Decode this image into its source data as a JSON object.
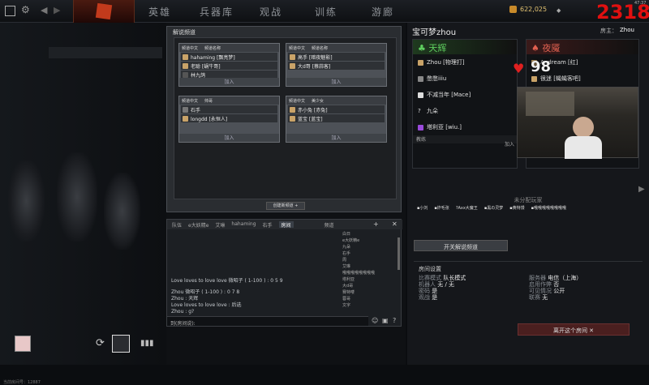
{
  "topbar": {
    "tabs": [
      "英雄",
      "兵器库",
      "观战",
      "训练",
      "游廊"
    ],
    "gold": "622,025",
    "score": "2318",
    "time": "47:37"
  },
  "panel": {
    "title": "解说频道",
    "channels": [
      {
        "head": [
          "频道中文",
          "频道名称"
        ],
        "rows": [
          "hahaming [飘亮梦]",
          "老聪 [蜗牛哥]",
          "林九鸽"
        ],
        "join": "加入"
      },
      {
        "head": [
          "频道中文",
          "频道名称"
        ],
        "rows": [
          "高手 [暗夜魅影]",
          "大d哥 [蔡蒜客]"
        ],
        "join": "加入"
      },
      {
        "head": [
          "频道中文",
          "帅哥"
        ],
        "rows": [
          "石手",
          "longdd [永恒人]"
        ],
        "join": "加入"
      },
      {
        "head": [
          "频道中文",
          "美少女"
        ],
        "rows": [
          "赤小兔 [赤兔]",
          "蓝宝 [蓝宝]"
        ],
        "join": "加入"
      }
    ],
    "create": "创建新频道 +"
  },
  "chat": {
    "tabs": [
      "队伍",
      "e大妖精e",
      "艾琳",
      "hahaming",
      "右手",
      "房间"
    ],
    "channel_tab": "频道",
    "users": [
      "白日",
      "e大妖精e",
      "九朵",
      "右手",
      "周",
      "艾琳",
      "哦哦哦哦哦哦哦哦",
      "塔利亚",
      "大d哥",
      "赛特喽",
      "蓉哥",
      "文字"
    ],
    "lines": [
      "Love loves to love love 微昭子 ( 1-100 ) : 0 5 9",
      "Zhou 微昭子 ( 1-100 ) : 0 7 8",
      "Zhou : 天辉",
      "Love loves to love love : 后选",
      "Zhou : g?"
    ],
    "input_label": "到(房间说):"
  },
  "room": {
    "title": "宝可梦zhou",
    "host_label": "房主：",
    "host": "Zhou",
    "radiant": "天辉",
    "dire": "夜魇",
    "radiant_players": [
      "Zhou [物理打]",
      "憋憋iiiu",
      "不减当年 [Mace]",
      "九朵",
      "塔利亚 [wiu.]"
    ],
    "dire_players": [
      "Audream [红]",
      "很迷 [蝇蝇客吧]"
    ],
    "coach": "教练",
    "coach_join": "加入",
    "unassigned": "未分配玩家",
    "unassigned_players": [
      "小刘",
      "炸毛张",
      "Axx大魔王",
      "黑の灵梦",
      "黄特馒",
      "哦哦哦哦哦哦哦哦"
    ],
    "toggle_btn": "开关解说频道",
    "settings_title": "房间设置",
    "settings": [
      [
        "比赛模式",
        "队长模式"
      ],
      [
        "机器人",
        "无 / 无"
      ],
      [
        "密码",
        "是"
      ],
      [
        "观战",
        "是"
      ]
    ],
    "settings_r": [
      [
        "服务器",
        "电信（上海）"
      ],
      [
        "启用作弊",
        "否"
      ],
      [
        "可见情况",
        "公开"
      ],
      [
        "联赛",
        "无"
      ]
    ],
    "leave": "离开这个房间 ✕"
  },
  "overlay": {
    "likes": "98"
  },
  "footer": {
    "room_id": "当前房间号：12887"
  }
}
